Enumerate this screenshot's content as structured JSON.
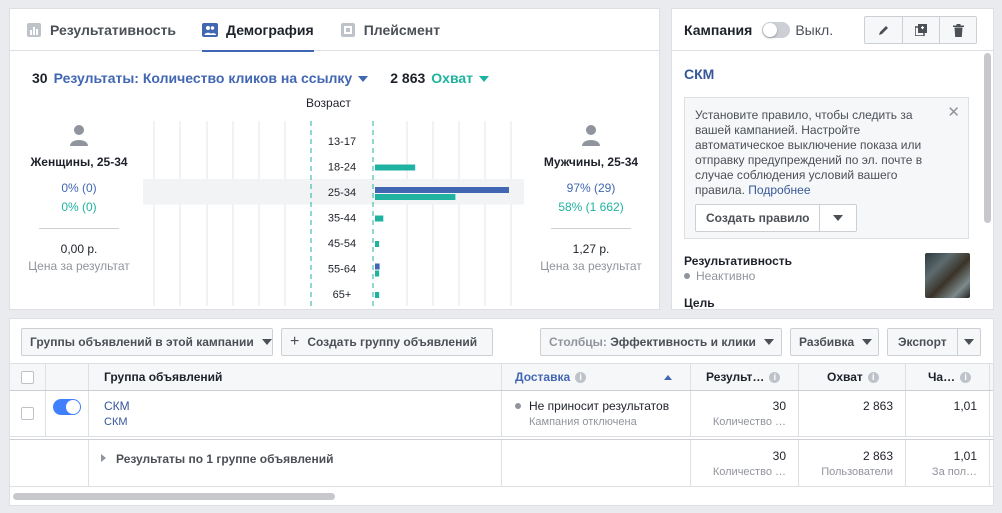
{
  "tabs": [
    {
      "label": "Результативность",
      "icon": "bar-chart-icon",
      "active": false
    },
    {
      "label": "Демография",
      "icon": "people-icon",
      "active": true
    },
    {
      "label": "Плейсмент",
      "icon": "placement-icon",
      "active": false
    }
  ],
  "metrics": {
    "results_count": "30",
    "results_label": "Результаты: Количество кликов на ссылку",
    "reach_count": "2 863",
    "reach_label": "Охват"
  },
  "chart_title": "Возраст",
  "women": {
    "label": "Женщины, 25-34",
    "pct_results": "0% (0)",
    "pct_reach": "0% (0)",
    "cost": "0,00 р.",
    "cost_label": "Цена за результат"
  },
  "men": {
    "label": "Мужчины, 25-34",
    "pct_results": "97% (29)",
    "pct_reach": "58% (1 662)",
    "cost": "1,27 р.",
    "cost_label": "Цена за результат"
  },
  "chart_data": {
    "type": "bar",
    "categories": [
      "13-17",
      "18-24",
      "25-34",
      "35-44",
      "45-54",
      "55-64",
      "65+"
    ],
    "highlighted_category": "25-34",
    "series": [
      {
        "name": "Мужчины · Результаты",
        "side": "right",
        "color": "#4267b2",
        "values": [
          0,
          0,
          29,
          0,
          0,
          1,
          0
        ]
      },
      {
        "name": "Мужчины · Охват",
        "side": "right",
        "color": "#20b2a0",
        "values": [
          0,
          0.29,
          0.58,
          0.06,
          0.03,
          0.03,
          0.03
        ]
      },
      {
        "name": "Женщины · Результаты",
        "side": "left",
        "color": "#4267b2",
        "values": [
          0,
          0,
          0,
          0,
          0,
          0,
          0
        ]
      },
      {
        "name": "Женщины · Охват",
        "side": "left",
        "color": "#20b2a0",
        "values": [
          0,
          0,
          0,
          0,
          0,
          0,
          0
        ]
      }
    ],
    "results_max": 29,
    "reach_max": 0.58
  },
  "right_panel": {
    "title": "Кампания",
    "toggle_label": "Выкл.",
    "campaign_name": "СКМ",
    "notice_text": "Установите правило, чтобы следить за вашей кампанией. Настройте автоматическое выключение показа или отправку предупреждений по эл. почте в случае соблюдения условий вашего правила.",
    "notice_link": "Подробнее",
    "create_rule": "Создать правило",
    "perf_label": "Результативность",
    "perf_state": "Неактивно",
    "goal_label": "Цель"
  },
  "toolbar": {
    "adsets_filter": "Группы объявлений в этой кампании",
    "create_adset": "Создать группу объявлений",
    "columns_prefix": "Столбцы:",
    "columns_value": "Эффективность и клики",
    "breakdown": "Разбивка",
    "export": "Экспорт"
  },
  "table": {
    "headers": {
      "name": "Группа объявлений",
      "delivery": "Доставка",
      "results": "Результ…",
      "reach": "Охват",
      "freq": "Ча…"
    },
    "row": {
      "name": "СКМ",
      "campaign": "СКМ",
      "delivery": "Не приносит результатов",
      "delivery_sub": "Кампания отключена",
      "results": "30",
      "results_sub": "Количество …",
      "reach": "2 863",
      "freq": "1,01"
    },
    "summary": {
      "label": "Результаты по 1 группе объявлений",
      "results": "30",
      "results_sub": "Количество …",
      "reach": "2 863",
      "reach_sub": "Пользователи",
      "freq": "1,01",
      "freq_sub": "За пол…"
    }
  }
}
